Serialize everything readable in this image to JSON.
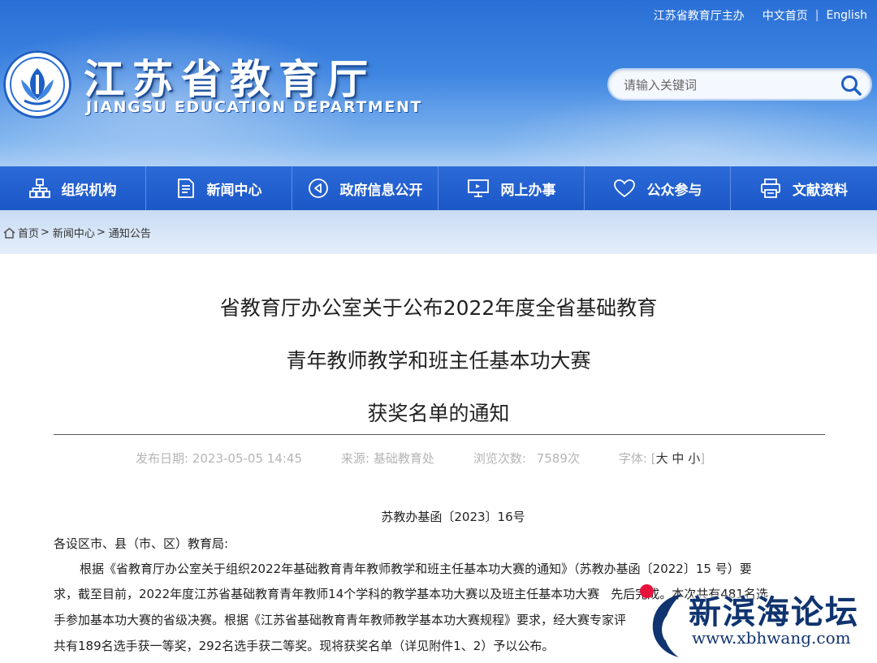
{
  "top_links": {
    "host": "江苏省教育厅主办",
    "cn_home": "中文首页",
    "en": "English"
  },
  "site": {
    "name_cn": "江苏省教育厅",
    "name_en": "JIANGSU EDUCATION DEPARTMENT"
  },
  "search": {
    "placeholder": "请输入关键词"
  },
  "nav": [
    {
      "label": "组织机构",
      "icon": "org-chart-icon"
    },
    {
      "label": "新闻中心",
      "icon": "document-icon"
    },
    {
      "label": "政府信息公开",
      "icon": "announce-icon"
    },
    {
      "label": "网上办事",
      "icon": "monitor-icon"
    },
    {
      "label": "公众参与",
      "icon": "heart-icon"
    },
    {
      "label": "文献资料",
      "icon": "printer-icon"
    }
  ],
  "breadcrumb": {
    "home": "首页",
    "sep": ">",
    "news": "新闻中心",
    "current": "通知公告"
  },
  "article": {
    "title_1": "省教育厅办公室关于公布2022年度全省基础教育",
    "title_2": "青年教师教学和班主任基本功大赛",
    "title_3": "获奖名单的通知",
    "date_label": "发布日期:",
    "date": "2023-05-05 14:45",
    "source_label": "来源:",
    "source": "基础教育处",
    "views_label": "浏览次数:",
    "views": "7589次",
    "font_label": "字体:",
    "font_open": "[",
    "font_large": "大",
    "font_medium": "中",
    "font_small": "小",
    "font_close": "]",
    "doc_number": "苏教办基函〔2023〕16号",
    "salutation": "各设区市、县（市、区）教育局:",
    "para_1": "根据《省教育厅办公室关于组织2022年基础教育青年教师教学和班主任基本功大赛的通知》（苏教办基函〔2022〕15 号）要",
    "para_2": "求，截至目前，2022年度江苏省基础教育青年教师14个学科的教学基本功大赛以及班主任基本功大赛",
    "para_2_tail": "先后完成。本次共有481名选",
    "para_3": "手参加基本功大赛的省级决赛。根据《江苏省基础教育青年教师教学基本功大赛规程》要求，经大赛专家评",
    "para_4": "共有189名选手获一等奖，292名选手获二等奖。现将获奖名单（详见附件1、2）予以公布。"
  },
  "watermark": {
    "name": "新滨海论坛",
    "url": "www.xbhwang.com"
  },
  "colors": {
    "nav_bg": "#1f5fd0",
    "header_top": "#2a6fd6",
    "watermark_dot": "#e8123c",
    "watermark_text": "#10346f"
  }
}
